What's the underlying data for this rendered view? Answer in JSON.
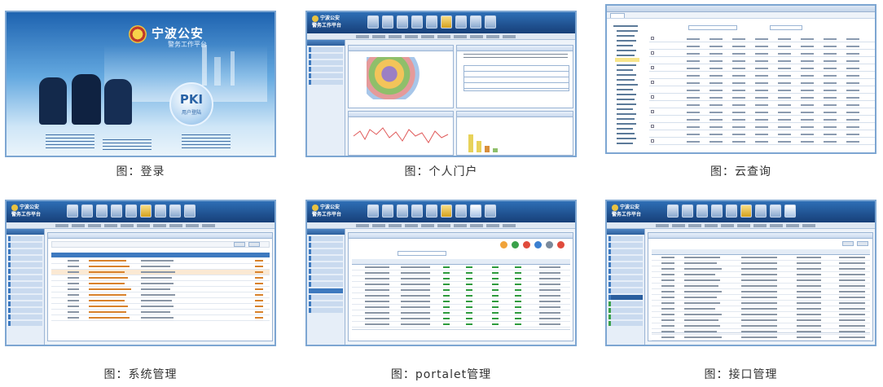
{
  "captions": {
    "login": "图：登录",
    "portal": "图：个人门户",
    "cloud_query": "图：云查询",
    "system_admin": "图：系统管理",
    "portalet_admin": "图：portalet管理",
    "api_admin": "图：接口管理"
  },
  "login_screen": {
    "brand_title": "宁波公安",
    "brand_subtitle": "警务工作平台",
    "pki_label": "PKI",
    "pki_sublabel": "用户登陆"
  },
  "app_header": {
    "brand_line1": "宁波公安",
    "brand_line2": "警务工作平台"
  },
  "colors": {
    "frame_border": "#7da6d2",
    "header_blue": "#1f4f8f",
    "login_bg": "#3a86c8",
    "orange_link": "#d9822b",
    "status_green": "#2e9b3e"
  }
}
